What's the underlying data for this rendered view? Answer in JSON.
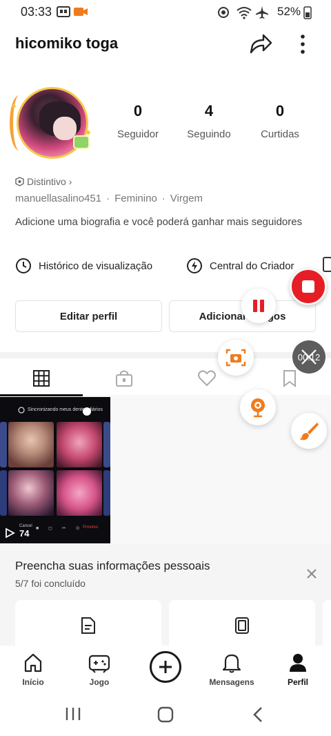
{
  "status_bar": {
    "time": "03:33",
    "battery": "52%",
    "icons": [
      "notification-icon",
      "video-record-icon",
      "sync-icon",
      "wifi-icon",
      "airplane-icon",
      "battery-icon"
    ]
  },
  "profile": {
    "username": "hicomiko toga",
    "stats": [
      {
        "value": "0",
        "label": "Seguidor"
      },
      {
        "value": "4",
        "label": "Seguindo"
      },
      {
        "value": "0",
        "label": "Curtidas"
      }
    ],
    "badge_label": "Distintivo",
    "handle": "manuellasalino451",
    "gender": "Feminino",
    "sign": "Virgem",
    "separator": "·",
    "bio": "Adicione uma biografia e você poderá ganhar mais seguidores"
  },
  "links": {
    "history": "Histórico de visualização",
    "creator_center": "Central do Criador"
  },
  "actions": {
    "edit_profile": "Editar perfil",
    "add_friends": "Adicionar amigos"
  },
  "tabs": [
    {
      "icon": "grid-icon",
      "active": true
    },
    {
      "icon": "lock-bag-icon",
      "active": false
    },
    {
      "icon": "heart-icon",
      "active": false
    },
    {
      "icon": "bookmark-icon",
      "active": false
    }
  ],
  "video": {
    "views": "74",
    "header": "Sincronizando meus dentes diários",
    "cancel": "Cancel",
    "next": "Próximo"
  },
  "personal_info": {
    "title": "Preencha suas informações pessoais",
    "progress": "5/7 foi concluído"
  },
  "bottom_nav": [
    {
      "label": "Início",
      "icon": "home-icon"
    },
    {
      "label": "Jogo",
      "icon": "gamepad-icon"
    },
    {
      "label": "",
      "icon": "plus-icon"
    },
    {
      "label": "Mensagens",
      "icon": "bell-icon"
    },
    {
      "label": "Perfil",
      "icon": "person-icon",
      "active": true
    }
  ],
  "recorder": {
    "timer": "00:12"
  },
  "colors": {
    "accent_red": "#e51e25",
    "accent_orange": "#f07b1c"
  }
}
